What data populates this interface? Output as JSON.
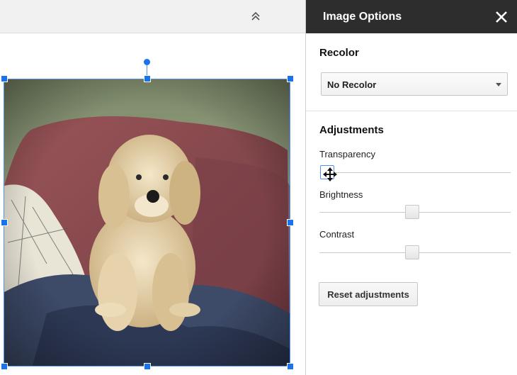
{
  "panel": {
    "title": "Image Options",
    "close_icon": "close-icon",
    "recolor": {
      "heading": "Recolor",
      "selected": "No Recolor"
    },
    "adjustments": {
      "heading": "Adjustments",
      "sliders": [
        {
          "label": "Transparency",
          "value": 0.0
        },
        {
          "label": "Brightness",
          "value": 0.5
        },
        {
          "label": "Contrast",
          "value": 0.5
        }
      ],
      "reset_label": "Reset adjustments"
    }
  },
  "toolbar": {
    "collapse_icon": "double-chevron-up-icon"
  },
  "image": {
    "subject_icon": "photo-image"
  },
  "colors": {
    "header_bg": "#2d2d2d",
    "selection_blue": "#1a73e8",
    "sofa_red": "#8a4a4f",
    "pillow_blue": "#3d4a68"
  }
}
